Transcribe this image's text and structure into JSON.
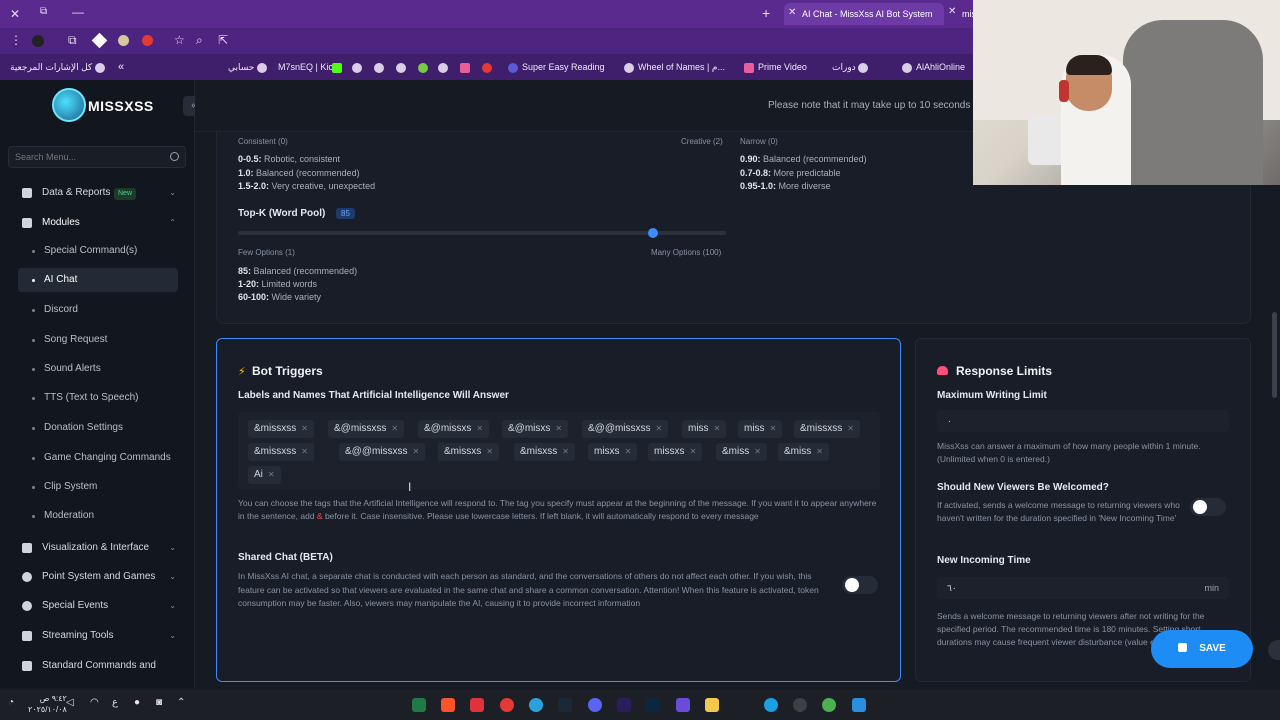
{
  "browser": {
    "active_tab": "AI Chat - MissXss AI Bot System",
    "next_tab": "mis",
    "bookmarks": [
      "كل الإشارات المرجعية",
      "حسابي",
      "M7snEQ | Kick",
      "Super Easy Reading",
      "Wheel of Names | م...",
      "Prime Video",
      "دورات",
      "AlAhliOnline"
    ]
  },
  "app": {
    "logo_text": "MISSXSS",
    "notice": "Please note that it may take up to 10 seconds"
  },
  "sidebar": {
    "search_placeholder": "Search Menu...",
    "items": {
      "data_reports": "Data & Reports",
      "new_badge": "New",
      "modules": "Modules",
      "special_commands": "Special Command(s)",
      "ai_chat": "AI Chat",
      "discord": "Discord",
      "song_request": "Song Request",
      "sound_alerts": "Sound Alerts",
      "tts": "TTS (Text to Speech)",
      "donation_settings": "Donation Settings",
      "game_changing": "Game Changing Commands",
      "clip_system": "Clip System",
      "moderation": "Moderation",
      "visualization": "Visualization & Interface",
      "point_system": "Point System and Games",
      "special_events": "Special Events",
      "streaming_tools": "Streaming Tools",
      "standard_commands": "Standard Commands and"
    }
  },
  "top_settings": {
    "consistent_label": "Consistent (0)",
    "creative_label": "Creative (2)",
    "narrow_label": "Narrow (0)",
    "temp_lines": [
      {
        "key": "0-0.5:",
        "text": " Robotic, consistent"
      },
      {
        "key": "1.0:",
        "text": " Balanced (recommended)"
      },
      {
        "key": "1.5-2.0:",
        "text": " Very creative, unexpected"
      }
    ],
    "topp_lines": [
      {
        "key": "0.90:",
        "text": " Balanced (recommended)"
      },
      {
        "key": "0.7-0.8:",
        "text": " More predictable"
      },
      {
        "key": "0.95-1.0:",
        "text": " More diverse"
      }
    ],
    "topk_label": "Top-K (Word Pool)",
    "topk_value": "85",
    "topk_fraction": 0.85,
    "few_options": "Few Options (1)",
    "many_options": "Many Options (100)",
    "topk_lines": [
      {
        "key": "85:",
        "text": " Balanced (recommended)"
      },
      {
        "key": "1-20:",
        "text": " Limited words"
      },
      {
        "key": "60-100:",
        "text": " Wide variety"
      }
    ]
  },
  "bot_triggers": {
    "title": "Bot Triggers",
    "subtitle": "Labels and Names That Artificial Intelligence Will Answer",
    "tags": [
      "&missxss",
      "&@missxss",
      "&@missxs",
      "&@misxs",
      "&@@missxss",
      "miss",
      "miss",
      "&missxss",
      "&missxss",
      "&@@missxss",
      "&missxs",
      "&misxss",
      "misxs",
      "missxs",
      "&miss",
      "&miss",
      "Ai"
    ],
    "help_a": "You can choose the tags that the Artificial Intelligence will respond to. The tag you specify must appear at the beginning of the message. If you want it to appear anywhere in the sentence, add ",
    "help_symbol": "&",
    "help_b": " before it. Case insensitive. Please use lowercase letters. If left blank, it will automatically respond to every message",
    "shared_title": "Shared Chat (BETA)",
    "shared_desc": "In MissXss AI chat, a separate chat is conducted with each person as standard, and the conversations of others do not affect each other. If you wish, this feature can be activated so that viewers are evaluated in the same chat and share a common conversation. Attention! When this feature is activated, token consumption may be faster. Also, viewers may manipulate the AI, causing it to provide incorrect information",
    "shared_enabled": false
  },
  "response_limits": {
    "title": "Response Limits",
    "max_label": "Maximum Writing Limit",
    "max_value": "٠",
    "max_help": "MissXss can answer a maximum of how many people within 1 minute. (Unlimited when 0 is entered.)",
    "welcome_label": "Should New Viewers Be Welcomed?",
    "welcome_help": "If activated, sends a welcome message to returning viewers who haven't written for the duration specified in 'New Incoming Time'",
    "welcome_enabled": false,
    "incoming_label": "New Incoming Time",
    "incoming_value": "٦٠",
    "incoming_unit": "min",
    "incoming_help": "Sends a welcome message to returning viewers after not writing for the specified period. The recommended time is 180 minutes. Setting short durations may cause frequent viewer disturbance (value entered in minutes.)"
  },
  "save_label": "SAVE",
  "taskbar": {
    "time": "٩:٤٢ ص",
    "date": "٢٠٢٥/١٠/٠٨"
  }
}
